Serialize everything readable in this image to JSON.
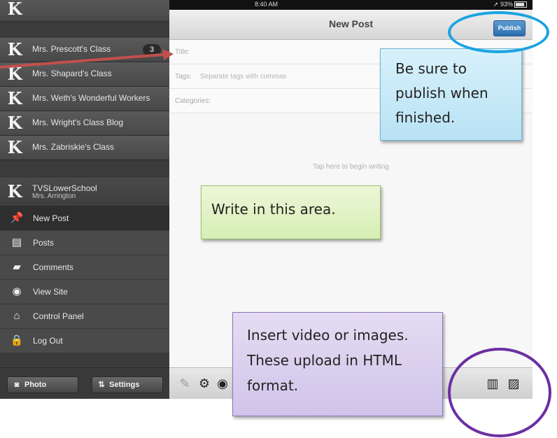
{
  "status_bar": {
    "device": "iPad",
    "wifi_icon": "wifi-icon",
    "time": "8:40 AM",
    "battery_percent": "93%"
  },
  "sidebar": {
    "sites": [
      {
        "label": "Mrs. Prescott's Class",
        "badge": "3"
      },
      {
        "label": "Mrs. Shapard's Class"
      },
      {
        "label": "Mrs. Weth's Wonderful Workers"
      },
      {
        "label": "Mrs. Wright's Class Blog"
      },
      {
        "label": "Mrs. Zabriskie's Class"
      },
      {
        "label": "TVSLowerSchool",
        "sublabel": "Mrs. Arrington"
      }
    ],
    "menu": [
      {
        "label": "New Post",
        "icon": "pin-icon"
      },
      {
        "label": "Posts",
        "icon": "posts-icon"
      },
      {
        "label": "Comments",
        "icon": "comments-icon"
      },
      {
        "label": "View Site",
        "icon": "eye-icon"
      },
      {
        "label": "Control Panel",
        "icon": "home-icon"
      },
      {
        "label": "Log Out",
        "icon": "lock-icon"
      }
    ],
    "photo_button": "Photo",
    "settings_button": "Settings"
  },
  "editor": {
    "nav_title": "New Post",
    "publish_label": "Publish",
    "title_label": "Title:",
    "tags_label": "Tags:",
    "tags_placeholder": "Separate tags with commas",
    "categories_label": "Categories:",
    "body_hint": "Tap here to begin writing"
  },
  "annotations": {
    "publish_note": "Be sure to publish when finished.",
    "write_note": "Write in this area.",
    "insert_note": "Insert video or images. These upload in HTML format."
  },
  "colors": {
    "highlight_blue": "#1aa3e0",
    "highlight_purple": "#6b2fa3",
    "arrow_red": "#c0504d",
    "publish_button": "#2d6fae"
  }
}
